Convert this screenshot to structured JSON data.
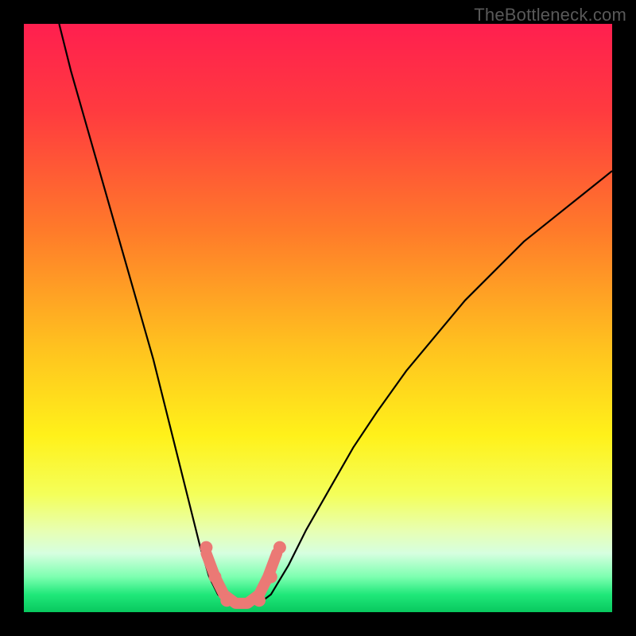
{
  "watermark": "TheBottleneck.com",
  "chart_data": {
    "type": "line",
    "title": "",
    "xlabel": "",
    "ylabel": "",
    "xlim": [
      0,
      100
    ],
    "ylim": [
      0,
      100
    ],
    "grid": false,
    "legend": false,
    "gradient_stops": [
      {
        "pos": 0.0,
        "color": "#ff1f4f"
      },
      {
        "pos": 0.15,
        "color": "#ff3b3f"
      },
      {
        "pos": 0.35,
        "color": "#ff7a2a"
      },
      {
        "pos": 0.55,
        "color": "#ffc21f"
      },
      {
        "pos": 0.7,
        "color": "#fff11a"
      },
      {
        "pos": 0.8,
        "color": "#f4ff5a"
      },
      {
        "pos": 0.86,
        "color": "#e8ffb0"
      },
      {
        "pos": 0.9,
        "color": "#d6ffe0"
      },
      {
        "pos": 0.94,
        "color": "#7dffb0"
      },
      {
        "pos": 0.97,
        "color": "#20e87a"
      },
      {
        "pos": 1.0,
        "color": "#08c85e"
      }
    ],
    "series": [
      {
        "name": "left-curve",
        "stroke": "#000000",
        "stroke_width": 2.2,
        "x": [
          6,
          8,
          10,
          12,
          14,
          16,
          18,
          20,
          22,
          24,
          26,
          28,
          30,
          31.5,
          33,
          34.5
        ],
        "y": [
          100,
          92,
          85,
          78,
          71,
          64,
          57,
          50,
          43,
          35,
          27,
          19,
          11,
          6,
          3,
          1.5
        ]
      },
      {
        "name": "right-curve",
        "stroke": "#000000",
        "stroke_width": 2.2,
        "x": [
          40,
          42,
          45,
          48,
          52,
          56,
          60,
          65,
          70,
          75,
          80,
          85,
          90,
          95,
          100
        ],
        "y": [
          1.5,
          3,
          8,
          14,
          21,
          28,
          34,
          41,
          47,
          53,
          58,
          63,
          67,
          71,
          75
        ]
      },
      {
        "name": "trough-connector",
        "stroke": "#eb7975",
        "stroke_width": 14,
        "linecap": "round",
        "x": [
          31,
          32.5,
          34,
          36,
          38,
          40,
          41.5,
          43
        ],
        "y": [
          10,
          6,
          3,
          1.5,
          1.5,
          3,
          6,
          10
        ]
      }
    ],
    "markers": [
      {
        "cx": 31.0,
        "cy": 11,
        "r": 8,
        "fill": "#eb7975"
      },
      {
        "cx": 32.5,
        "cy": 6,
        "r": 8,
        "fill": "#eb7975"
      },
      {
        "cx": 34.5,
        "cy": 2,
        "r": 8,
        "fill": "#eb7975"
      },
      {
        "cx": 40.0,
        "cy": 2,
        "r": 8,
        "fill": "#eb7975"
      },
      {
        "cx": 42.0,
        "cy": 6,
        "r": 8,
        "fill": "#eb7975"
      },
      {
        "cx": 43.5,
        "cy": 11,
        "r": 8,
        "fill": "#eb7975"
      }
    ]
  }
}
